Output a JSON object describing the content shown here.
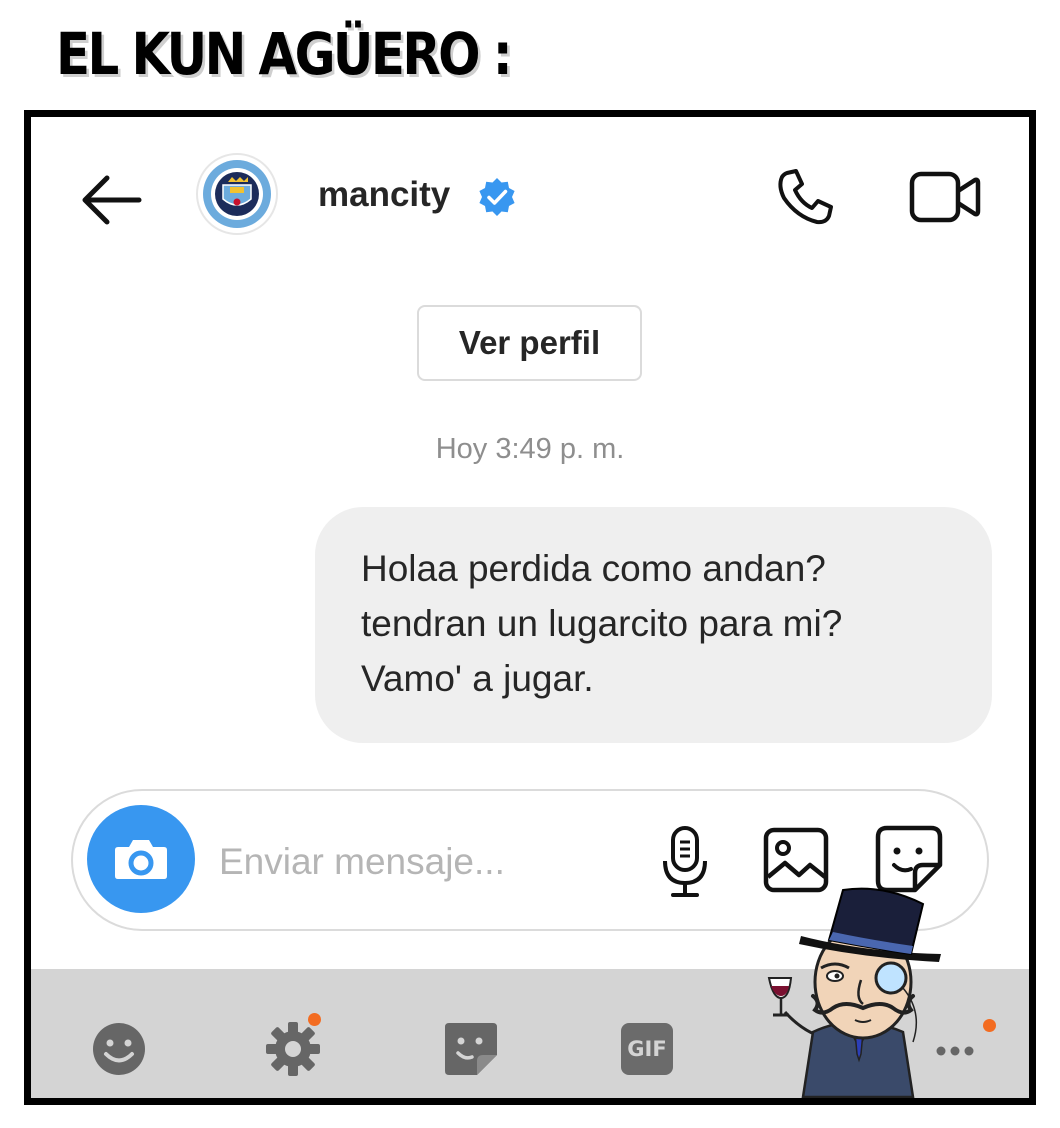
{
  "meme": {
    "caption": "EL KUN AGÜERO :"
  },
  "header": {
    "username": "mancity",
    "verified": true
  },
  "chat": {
    "view_profile_label": "Ver perfil",
    "timestamp": "Hoy 3:49 p. m.",
    "messages": [
      {
        "lines": [
          "Holaa perdida como andan?",
          "tendran un lugarcito para mi?",
          "Vamo' a jugar."
        ]
      }
    ]
  },
  "composer": {
    "placeholder": "Enviar mensaje..."
  },
  "icons": {
    "header": [
      "back-arrow-icon",
      "mancity-crest-avatar",
      "verified-badge-icon",
      "phone-icon",
      "video-camera-icon"
    ],
    "composer": [
      "camera-icon",
      "microphone-icon",
      "gallery-icon",
      "sticker-icon"
    ],
    "keyboard": [
      "emoji-icon",
      "settings-icon",
      "sticker-icon",
      "gif-icon",
      "more-icon"
    ]
  },
  "keyboard": {
    "gif_label": "GIF"
  },
  "colors": {
    "accent_blue": "#3897f0",
    "verified_blue": "#3897f0",
    "bubble_bg": "#efefef",
    "keyboard_bg": "#d4d4d4",
    "notification_dot": "#f36c21"
  }
}
